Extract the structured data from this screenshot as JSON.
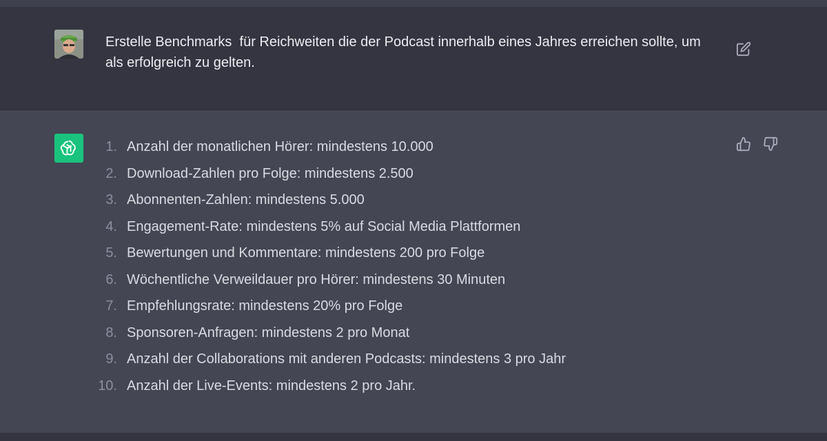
{
  "user_message": {
    "text": "Erstelle Benchmarks  für Reichweiten die der Podcast innerhalb eines Jahres erreichen sollte, um als erfolgreich zu gelten."
  },
  "assistant_message": {
    "items": [
      {
        "num": "1.",
        "text": "Anzahl der monatlichen Hörer: mindestens 10.000"
      },
      {
        "num": "2.",
        "text": "Download-Zahlen pro Folge: mindestens 2.500"
      },
      {
        "num": "3.",
        "text": "Abonnenten-Zahlen: mindestens 5.000"
      },
      {
        "num": "4.",
        "text": "Engagement-Rate: mindestens 5% auf Social Media Plattformen"
      },
      {
        "num": "5.",
        "text": "Bewertungen und Kommentare: mindestens 200 pro Folge"
      },
      {
        "num": "6.",
        "text": "Wöchentliche Verweildauer pro Hörer: mindestens 30 Minuten"
      },
      {
        "num": "7.",
        "text": "Empfehlungsrate: mindestens 20% pro Folge"
      },
      {
        "num": "8.",
        "text": "Sponsoren-Anfragen: mindestens 2 pro Monat"
      },
      {
        "num": "9.",
        "text": "Anzahl der Collaborations mit anderen Podcasts: mindestens 3 pro Jahr"
      },
      {
        "num": "10.",
        "text": "Anzahl der Live-Events: mindestens 2 pro Jahr."
      }
    ]
  },
  "icons": {
    "edit": "edit-icon",
    "thumbs_up": "thumbs-up-icon",
    "thumbs_down": "thumbs-down-icon",
    "assistant_logo": "openai-logo-icon",
    "user_avatar": "user-avatar"
  },
  "colors": {
    "user_bg": "#343541",
    "assistant_bg": "#444654",
    "assistant_avatar": "#19c37d"
  }
}
